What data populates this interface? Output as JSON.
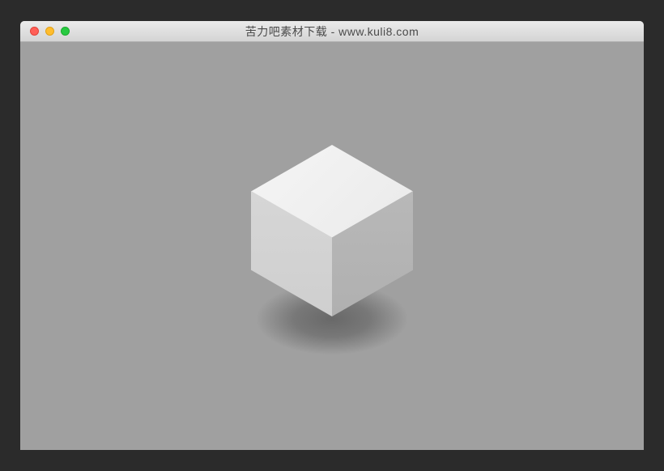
{
  "window": {
    "title": "苦力吧素材下载 - www.kuli8.com"
  },
  "colors": {
    "background": "#2b2b2b",
    "content_bg": "#a0a0a0",
    "cube_top": "#f0f0f0",
    "cube_left": "#d4d4d4",
    "cube_right": "#b4b4b4"
  }
}
